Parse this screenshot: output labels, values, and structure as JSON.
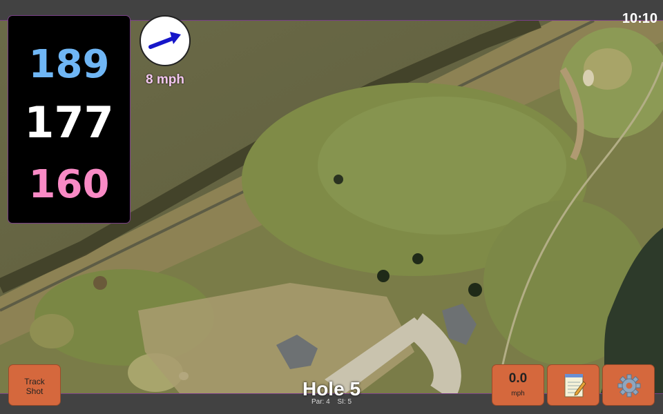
{
  "status": {
    "time": "10:10"
  },
  "distances": {
    "back": "189",
    "middle": "177",
    "front": "160"
  },
  "wind": {
    "speed": "8 mph",
    "icon": "wind-direction-arrow-icon"
  },
  "buttons": {
    "track_shot_label": "Track\nShot",
    "speed_value": "0.0",
    "speed_unit": "mph",
    "notes_icon": "notepad-icon",
    "settings_icon": "gear-icon"
  },
  "hole": {
    "title": "Hole 5",
    "par": "Par: 4",
    "si": "SI: 5"
  },
  "colors": {
    "back": "#6fb6f5",
    "middle": "#ffffff",
    "front": "#f98ac5",
    "button": "#d5683d",
    "accent_border": "#7a3f88"
  }
}
